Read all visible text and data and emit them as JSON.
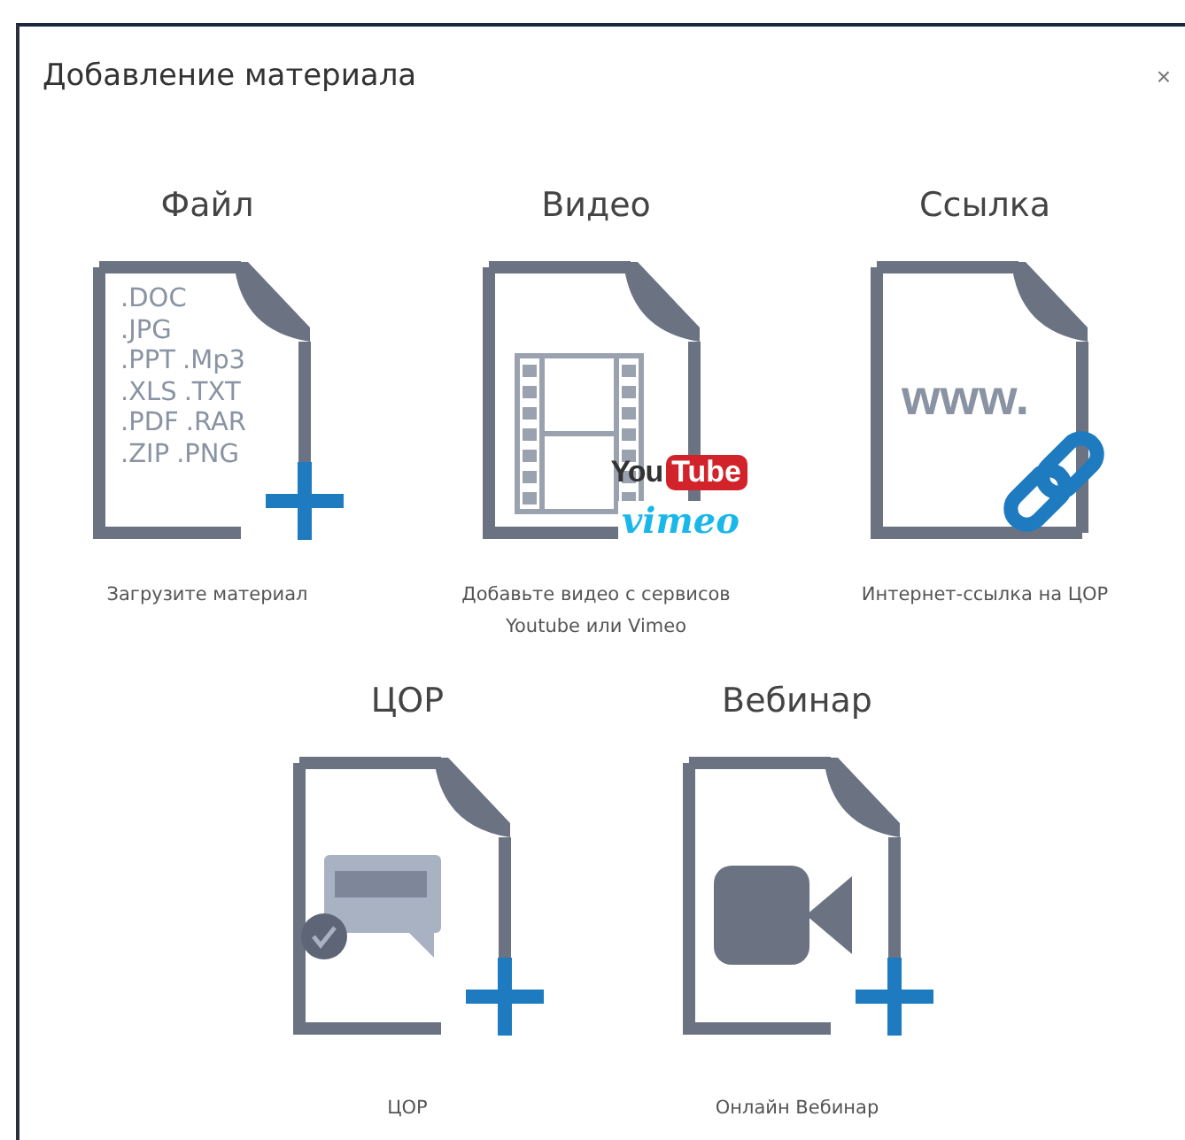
{
  "dialog": {
    "title": "Добавление материала",
    "close": "×"
  },
  "rows": [
    [
      {
        "kind": "file",
        "title": "Файл",
        "caption": "Загрузите материал",
        "plus": true,
        "lines": [
          [
            ".DOC"
          ],
          [
            ".JPG"
          ],
          [
            ".PPT",
            ".Mp3"
          ],
          [
            ".XLS",
            ".TXT"
          ],
          [
            ".PDF",
            ".RAR"
          ],
          [
            ".ZIP",
            ".PNG"
          ]
        ]
      },
      {
        "kind": "video",
        "title": "Видео",
        "caption": "Добавьте видео с сервисов Youtube или Vimeo",
        "plus": false,
        "logo_left": "You",
        "logo_right": "Tube",
        "logo_second": "vimeo"
      },
      {
        "kind": "link",
        "title": "Ссылка",
        "caption": "Интернет-ссылка на ЦОР",
        "plus": false,
        "mark": "www."
      }
    ],
    [
      {
        "kind": "cor",
        "title": "ЦОР",
        "caption": "ЦОР",
        "plus": true
      },
      {
        "kind": "webinar",
        "title": "Вебинар",
        "caption": "Онлайн Вебинар",
        "plus": true
      }
    ]
  ]
}
